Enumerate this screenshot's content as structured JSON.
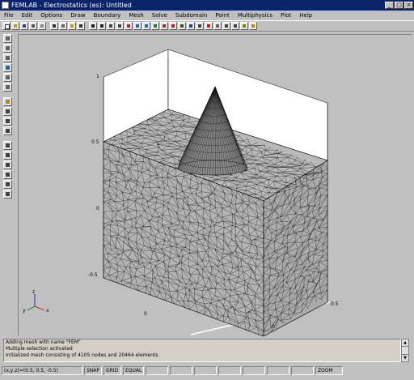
{
  "window": {
    "title": "FEMLAB - Electrostatics (es): Untitled",
    "min": "_",
    "max": "□",
    "close": "×"
  },
  "menu": [
    "File",
    "Edit",
    "Options",
    "Draw",
    "Boundary",
    "Mesh",
    "Solve",
    "Subdomain",
    "Point",
    "Multiphysics",
    "Plot",
    "Help"
  ],
  "axes": {
    "z_ticks": [
      "1",
      "0.5",
      "0",
      "-0.5"
    ],
    "x_ticks": [
      "0",
      "0.5"
    ],
    "y_ticks": [
      "0"
    ]
  },
  "triad": {
    "x": "x",
    "y": "y",
    "z": "z"
  },
  "console": {
    "lines": [
      "Adding mesh with name \"FEM\"",
      "Multiple selection activated",
      "Initialized mesh consisting of 4105 nodes and 20464 elements."
    ]
  },
  "status": {
    "coords": "(x,y,z)=(0.5, 0.5, -0.5)",
    "cells": [
      "SNAP",
      "GRID",
      "EQUAL",
      "",
      "",
      "",
      "",
      "",
      "",
      "",
      "ZOOM"
    ]
  },
  "colors": {
    "titlebar": "#0a246a",
    "chrome": "#c0c0c0",
    "mesh_face": "#b3b3b3",
    "mesh_line": "#111111"
  }
}
